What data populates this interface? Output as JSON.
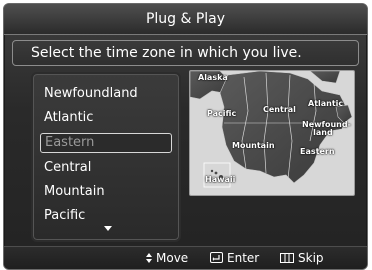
{
  "dialog": {
    "title": "Plug & Play",
    "prompt": "Select the time zone in which you live."
  },
  "time_zones": {
    "selected": "Eastern",
    "items": [
      {
        "label": "Newfoundland",
        "selected": false
      },
      {
        "label": "Atlantic",
        "selected": false
      },
      {
        "label": "Eastern",
        "selected": true
      },
      {
        "label": "Central",
        "selected": false
      },
      {
        "label": "Mountain",
        "selected": false
      },
      {
        "label": "Pacific",
        "selected": false
      }
    ],
    "scroll_icon": "scroll-down-arrow-icon"
  },
  "map": {
    "labels": {
      "alaska": "Alaska",
      "pacific": "Pacific",
      "central": "Central",
      "atlantic": "Atlantic",
      "newfoundland": "Newfound-\n    land",
      "mountain": "Mountain",
      "eastern": "Eastern",
      "hawaii": "Hawaii"
    }
  },
  "footer": {
    "move": {
      "icon": "up-down-arrow-icon",
      "label": "Move"
    },
    "enter": {
      "icon": "enter-icon",
      "label": "Enter"
    },
    "skip": {
      "icon": "skip-icon",
      "label": "Skip"
    }
  },
  "colors": {
    "panel_background": "#2a2a2a",
    "text": "#ffffff",
    "selected_text": "#9a9a9a",
    "map_background": "#d7d7d7",
    "map_land": "#4d4d4d"
  }
}
